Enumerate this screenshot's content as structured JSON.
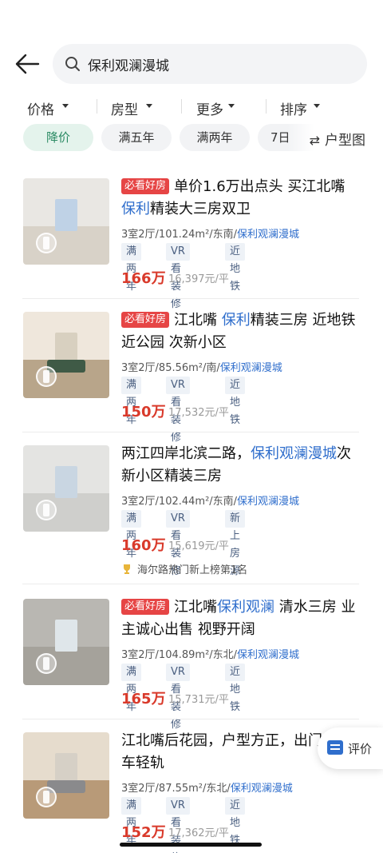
{
  "search": {
    "query": "保利观澜漫城"
  },
  "filters": [
    {
      "label": "价格"
    },
    {
      "label": "房型"
    },
    {
      "label": "更多"
    },
    {
      "label": "排序"
    }
  ],
  "chips": [
    {
      "label": "降价",
      "active": true
    },
    {
      "label": "满五年",
      "active": false
    },
    {
      "label": "满两年",
      "active": false
    },
    {
      "label": "7日",
      "active": false
    }
  ],
  "floorplan_button": {
    "label": "户型图",
    "icon": "swap-arrows-icon"
  },
  "listings": [
    {
      "badge": "必看好房",
      "title_parts": [
        {
          "text": "单价1.6万出点头 买江北嘴 ",
          "hl": false
        },
        {
          "text": "保利",
          "hl": true
        },
        {
          "text": "精装大三房双卫",
          "hl": false
        }
      ],
      "info_prefix": "3室2厅/101.24m²/东南/",
      "community": "保利观澜漫城",
      "tags": [
        "满两年",
        "VR看装修",
        "近地铁"
      ],
      "price": "166万",
      "unit_price": "16,397元/平",
      "rank": ""
    },
    {
      "badge": "必看好房",
      "title_parts": [
        {
          "text": "江北嘴 ",
          "hl": false
        },
        {
          "text": "保利",
          "hl": true
        },
        {
          "text": "精装三房 近地铁近公园 次新小区",
          "hl": false
        }
      ],
      "info_prefix": "3室2厅/85.56m²/南/",
      "community": "保利观澜漫城",
      "tags": [
        "满两年",
        "VR看装修",
        "近地铁"
      ],
      "price": "150万",
      "unit_price": "17,532元/平",
      "rank": ""
    },
    {
      "badge": "",
      "title_parts": [
        {
          "text": "两江四岸北滨二路，",
          "hl": false
        },
        {
          "text": "保利观澜漫城",
          "hl": true
        },
        {
          "text": "次新小区精装三房",
          "hl": false
        }
      ],
      "info_prefix": "3室2厅/102.44m²/东南/",
      "community": "保利观澜漫城",
      "tags": [
        "满两年",
        "VR看装修",
        "新上房源"
      ],
      "price": "160万",
      "unit_price": "15,619元/平",
      "rank": "海尔路热门新上榜第1名"
    },
    {
      "badge": "必看好房",
      "title_parts": [
        {
          "text": "江北嘴",
          "hl": false
        },
        {
          "text": "保利观澜",
          "hl": true
        },
        {
          "text": " 清水三房 业主诚心出售 视野开阔",
          "hl": false
        }
      ],
      "info_prefix": "3室2厅/104.89m²/东北/",
      "community": "保利观澜漫城",
      "tags": [
        "满两年",
        "VR看装修",
        "近地铁"
      ],
      "price": "165万",
      "unit_price": "15,731元/平",
      "rank": ""
    },
    {
      "badge": "",
      "title_parts": [
        {
          "text": "江北嘴后花园，户型方正，出门公交车轻轨",
          "hl": false
        }
      ],
      "info_prefix": "3室2厅/87.55m²/东北/",
      "community": "保利观澜漫城",
      "tags": [
        "满两年",
        "VR看装修",
        "近地铁"
      ],
      "price": "152万",
      "unit_price": "17,362元/平",
      "rank": ""
    }
  ],
  "review_button": {
    "label": "评价"
  },
  "colors": {
    "price": "#d93a2b",
    "highlight": "#2f6ecc",
    "badge": "#e64545",
    "chip_active": "#e4f3ec"
  }
}
